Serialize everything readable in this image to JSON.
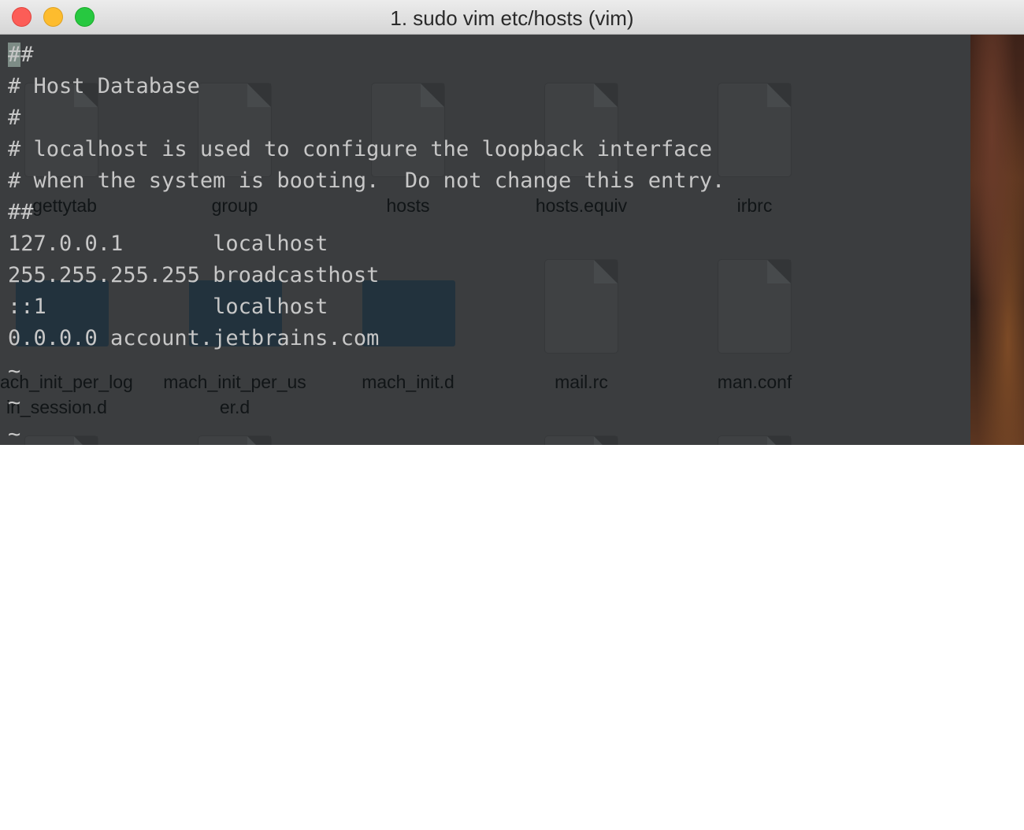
{
  "window": {
    "title": "1. sudo vim etc/hosts (vim)"
  },
  "editor": {
    "cursor_char": "#",
    "first_line_rest": "#",
    "lines": [
      "# Host Database",
      "#",
      "# localhost is used to configure the loopback interface",
      "# when the system is booting.  Do not change this entry.",
      "##",
      "127.0.0.1       localhost",
      "255.255.255.255 broadcasthost",
      "::1             localhost",
      "0.0.0.0 account.jetbrains.com"
    ],
    "empty_line_marker": "~"
  },
  "finder_background": {
    "files_row1": [
      "gettytab",
      "group",
      "hosts",
      "hosts.equiv",
      "irbrc"
    ],
    "files_row2": [
      "ach_init_per_log",
      "mach_init_per_us",
      "mach_init.d",
      "mail.rc",
      "man.conf"
    ],
    "files_row2_line2": [
      "in_session.d",
      "er.d"
    ]
  },
  "colors": {
    "terminal_bg": "#3a3c3e",
    "text": "#c7c7c7",
    "cursor": "#7d8c86"
  }
}
